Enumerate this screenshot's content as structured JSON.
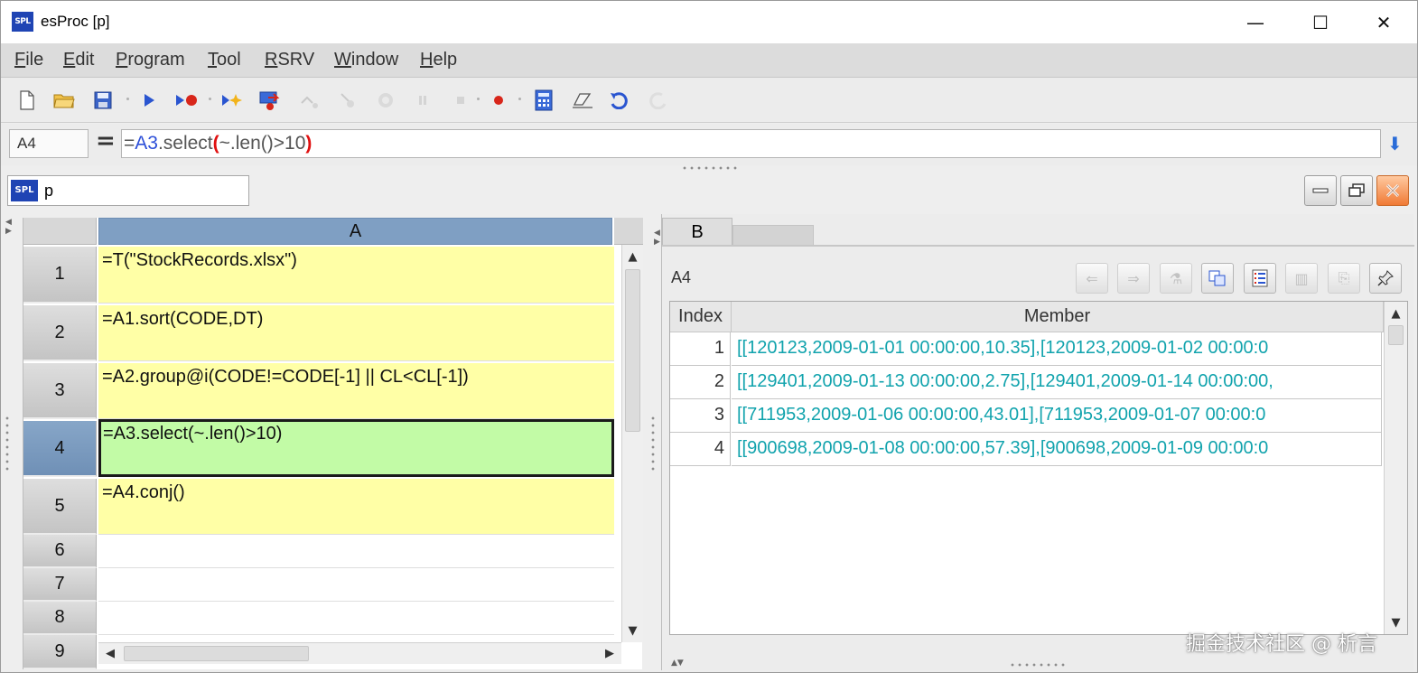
{
  "window": {
    "logo_text": "SPL",
    "title": "esProc  [p]",
    "controls": {
      "minimize": "—",
      "maximize": "☐",
      "close": "✕"
    }
  },
  "menu": [
    {
      "key": "F",
      "rest": "ile"
    },
    {
      "key": "E",
      "rest": "dit"
    },
    {
      "key": "P",
      "rest": "rogram"
    },
    {
      "key": "T",
      "rest": "ool"
    },
    {
      "key": "R",
      "rest": "SRV"
    },
    {
      "key": "W",
      "rest": "indow"
    },
    {
      "key": "H",
      "rest": "elp"
    }
  ],
  "toolbar_icons": [
    "new-file-icon",
    "open-folder-icon",
    "save-icon",
    "run-icon",
    "run-to-cursor-icon",
    "step-icon",
    "debug-icon",
    "step-over-icon",
    "step-into-icon",
    "step-return-icon",
    "pause-icon",
    "stop-icon",
    "breakpoint-icon",
    "calculator-icon",
    "eraser-icon",
    "undo-icon",
    "redo-icon"
  ],
  "formula": {
    "cell_ref": "A4",
    "equals": "=",
    "prefix": "=",
    "ref": "A3",
    "fn": ".select",
    "open_paren": "(",
    "arg": "~.len()>10",
    "close_paren": ")"
  },
  "doc": {
    "logo_text": "SPL",
    "name": "p"
  },
  "grid": {
    "column": "A",
    "rows": [
      {
        "num": "1",
        "formula": "=T(\"StockRecords.xlsx\")"
      },
      {
        "num": "2",
        "formula": "=A1.sort(CODE,DT)"
      },
      {
        "num": "3",
        "formula": "=A2.group@i(CODE!=CODE[-1] || CL<CL[-1])"
      },
      {
        "num": "4",
        "formula": "=A3.select(~.len()>10)"
      },
      {
        "num": "5",
        "formula": "=A4.conj()"
      },
      {
        "num": "6",
        "formula": ""
      },
      {
        "num": "7",
        "formula": ""
      },
      {
        "num": "8",
        "formula": ""
      },
      {
        "num": "9",
        "formula": ""
      }
    ],
    "active_row": "4"
  },
  "result": {
    "tab": "B",
    "cell_ref": "A4",
    "headers": {
      "index": "Index",
      "member": "Member"
    },
    "rows": [
      {
        "index": "1",
        "member": "[[120123,2009-01-01 00:00:00,10.35],[120123,2009-01-02 00:00:0"
      },
      {
        "index": "2",
        "member": "[[129401,2009-01-13 00:00:00,2.75],[129401,2009-01-14 00:00:00,"
      },
      {
        "index": "3",
        "member": "[[711953,2009-01-06 00:00:00,43.01],[711953,2009-01-07 00:00:0"
      },
      {
        "index": "4",
        "member": "[[900698,2009-01-08 00:00:00,57.39],[900698,2009-01-09 00:00:0"
      }
    ]
  },
  "watermark": "掘金技术社区 @ 析言",
  "colors": {
    "formula_cell": "#ffffa6",
    "active_cell": "#c2fba6",
    "column_header": "#7f9fc3",
    "result_text": "#11a3ad",
    "formula_ref": "#2d4fd8",
    "formula_paren": "#e01010"
  }
}
